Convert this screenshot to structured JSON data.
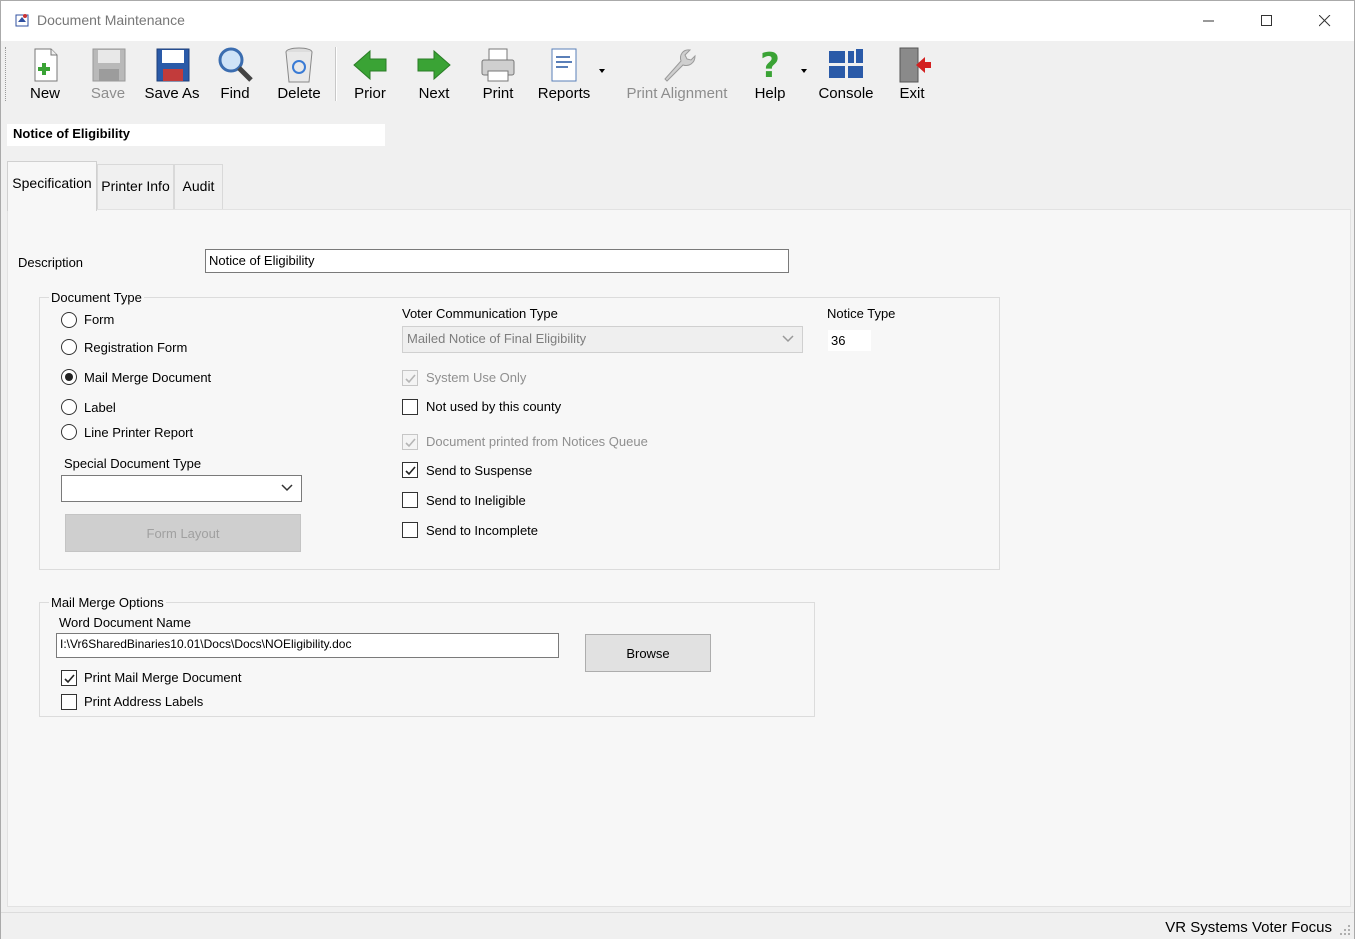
{
  "window": {
    "title": "Document Maintenance"
  },
  "toolbar": {
    "new": "New",
    "save": "Save",
    "save_as": "Save As",
    "find": "Find",
    "delete": "Delete",
    "prior": "Prior",
    "next": "Next",
    "print": "Print",
    "reports": "Reports",
    "print_alignment": "Print Alignment",
    "help": "Help",
    "console": "Console",
    "exit": "Exit"
  },
  "header": {
    "document_name": "Notice of Eligibility"
  },
  "tabs": [
    {
      "label": "Specification",
      "active": true
    },
    {
      "label": "Printer Info",
      "active": false
    },
    {
      "label": "Audit",
      "active": false
    }
  ],
  "spec": {
    "description_label": "Description",
    "description_value": "Notice of Eligibility",
    "document_type": {
      "title": "Document Type",
      "options": [
        "Form",
        "Registration Form",
        "Mail Merge Document",
        "Label",
        "Line Printer Report"
      ],
      "selected": "Mail Merge Document"
    },
    "special_document_type_label": "Special Document Type",
    "special_document_type_value": "",
    "form_layout_button": "Form Layout",
    "voter_comm_type_label": "Voter Communication Type",
    "voter_comm_type_value": "Mailed Notice of Final Eligibility",
    "notice_type_label": "Notice Type",
    "notice_type_value": "36",
    "checkboxes": {
      "system_use_only": {
        "label": "System Use Only",
        "checked": true,
        "enabled": false
      },
      "not_used_by_county": {
        "label": "Not used by this county",
        "checked": false,
        "enabled": true
      },
      "printed_from_queue": {
        "label": "Document printed from Notices Queue",
        "checked": true,
        "enabled": false
      },
      "send_to_suspense": {
        "label": "Send to Suspense",
        "checked": true,
        "enabled": true
      },
      "send_to_ineligible": {
        "label": "Send to Ineligible",
        "checked": false,
        "enabled": true
      },
      "send_to_incomplete": {
        "label": "Send to Incomplete",
        "checked": false,
        "enabled": true
      }
    }
  },
  "mail_merge": {
    "title": "Mail Merge Options",
    "word_doc_label": "Word Document Name",
    "word_doc_value": "I:\\Vr6SharedBinaries10.01\\Docs\\Docs\\NOEligibility.doc",
    "browse_button": "Browse",
    "print_mail_merge": {
      "label": "Print Mail Merge Document",
      "checked": true
    },
    "print_address_labels": {
      "label": "Print Address Labels",
      "checked": false
    }
  },
  "status": {
    "text": "VR Systems Voter Focus"
  },
  "colors": {
    "accent_green": "#3aa335",
    "save_blue": "#2a5aa8",
    "exit_red": "#d32020"
  }
}
